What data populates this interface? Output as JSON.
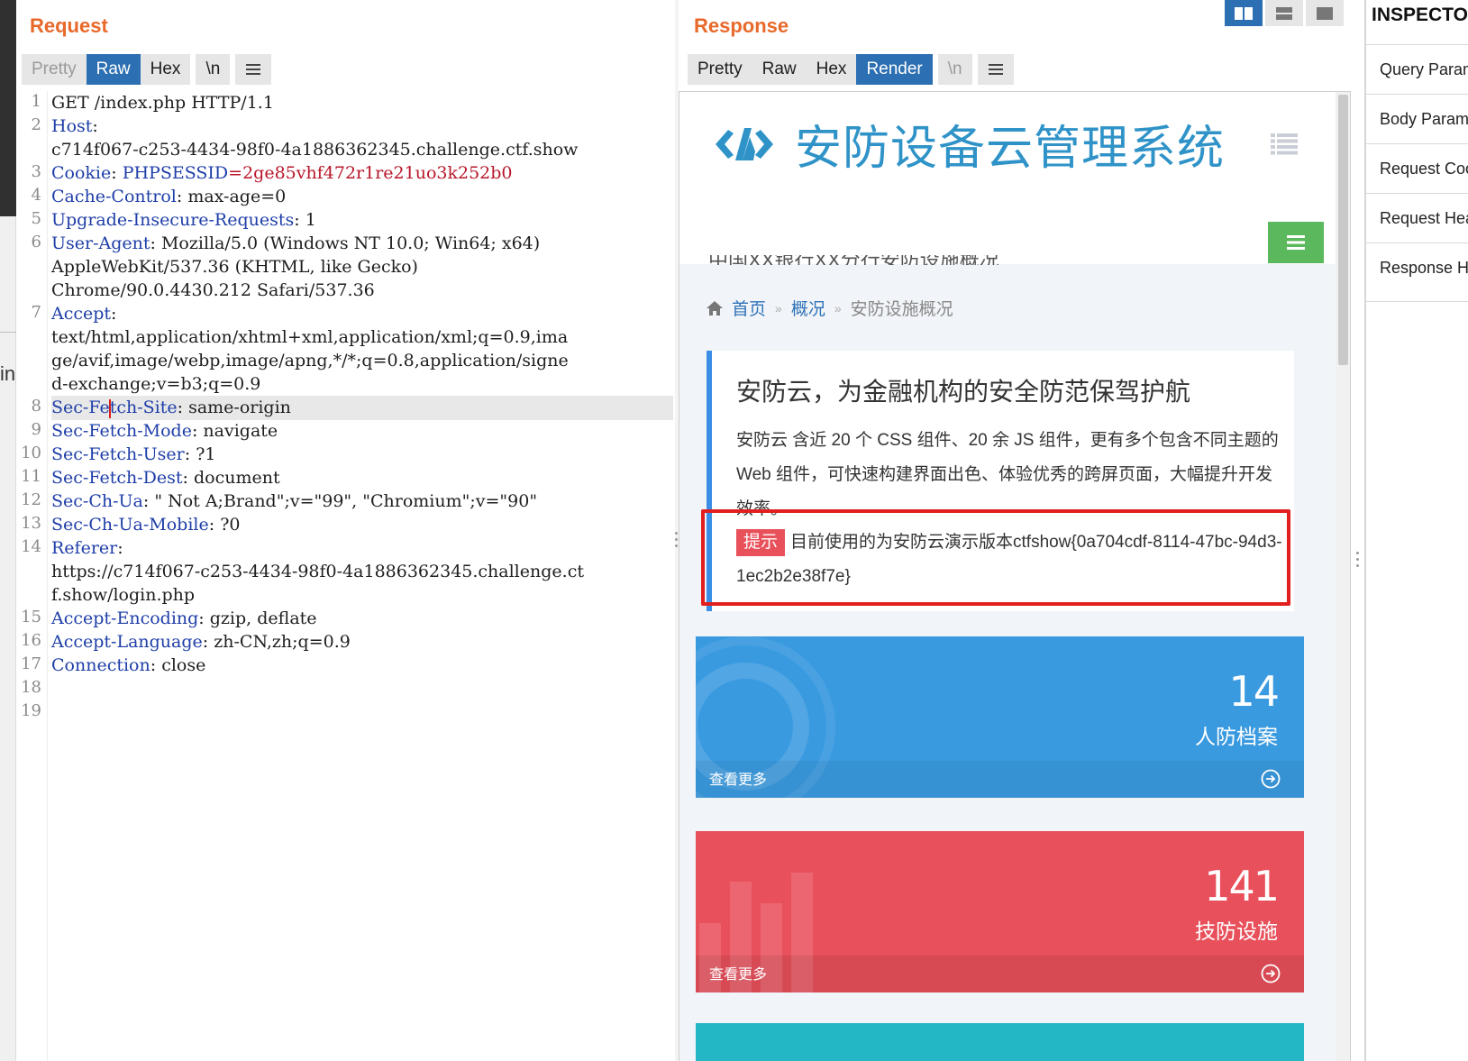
{
  "request": {
    "title": "Request",
    "tabs": [
      "Pretty",
      "Raw",
      "Hex",
      "\\n"
    ],
    "selected_tab": "Raw",
    "lines": [
      {
        "n": "1",
        "key": "",
        "sep": "",
        "value": "GET /index.php HTTP/1.1"
      },
      {
        "n": "2",
        "key": "Host",
        "sep": ":",
        "value": ""
      },
      {
        "n": "",
        "key": "",
        "sep": "",
        "value": "c714f067-c253-4434-98f0-4a1886362345.challenge.ctf.show"
      },
      {
        "n": "3",
        "key": "Cookie",
        "sep": ": ",
        "ckey": "PHPSESSID",
        "value": "=2ge85vhf472r1re21uo3k252b0"
      },
      {
        "n": "4",
        "key": "Cache-Control",
        "sep": ": ",
        "value": "max-age=0"
      },
      {
        "n": "5",
        "key": "Upgrade-Insecure-Requests",
        "sep": ": ",
        "value": "1"
      },
      {
        "n": "6",
        "key": "User-Agent",
        "sep": ": ",
        "value": "Mozilla/5.0 (Windows NT 10.0; Win64; x64)"
      },
      {
        "n": "",
        "key": "",
        "sep": "",
        "value": "AppleWebKit/537.36 (KHTML, like Gecko)"
      },
      {
        "n": "",
        "key": "",
        "sep": "",
        "value": "Chrome/90.0.4430.212 Safari/537.36"
      },
      {
        "n": "7",
        "key": "Accept",
        "sep": ":",
        "value": ""
      },
      {
        "n": "",
        "key": "",
        "sep": "",
        "value": "text/html,application/xhtml+xml,application/xml;q=0.9,ima"
      },
      {
        "n": "",
        "key": "",
        "sep": "",
        "value": "ge/avif,image/webp,image/apng,*/*;q=0.8,application/signe"
      },
      {
        "n": "",
        "key": "",
        "sep": "",
        "value": "d-exchange;v=b3;q=0.9"
      },
      {
        "n": "8",
        "key": "Sec-Fetch-Site",
        "sep": ": ",
        "value": "same-origin",
        "highlight": true
      },
      {
        "n": "9",
        "key": "Sec-Fetch-Mode",
        "sep": ": ",
        "value": "navigate"
      },
      {
        "n": "10",
        "key": "Sec-Fetch-User",
        "sep": ": ",
        "value": "?1"
      },
      {
        "n": "11",
        "key": "Sec-Fetch-Dest",
        "sep": ": ",
        "value": "document"
      },
      {
        "n": "12",
        "key": "Sec-Ch-Ua",
        "sep": ": ",
        "value": "\" Not A;Brand\";v=\"99\", \"Chromium\";v=\"90\""
      },
      {
        "n": "13",
        "key": "Sec-Ch-Ua-Mobile",
        "sep": ": ",
        "value": "?0"
      },
      {
        "n": "14",
        "key": "Referer",
        "sep": ":",
        "value": ""
      },
      {
        "n": "",
        "key": "",
        "sep": "",
        "value": "https://c714f067-c253-4434-98f0-4a1886362345.challenge.ct"
      },
      {
        "n": "",
        "key": "",
        "sep": "",
        "value": "f.show/login.php"
      },
      {
        "n": "15",
        "key": "Accept-Encoding",
        "sep": ": ",
        "value": "gzip, deflate"
      },
      {
        "n": "16",
        "key": "Accept-Language",
        "sep": ": ",
        "value": "zh-CN,zh;q=0.9"
      },
      {
        "n": "17",
        "key": "Connection",
        "sep": ": ",
        "value": "close"
      },
      {
        "n": "18",
        "key": "",
        "sep": "",
        "value": ""
      },
      {
        "n": "19",
        "key": "",
        "sep": "",
        "value": ""
      }
    ]
  },
  "response": {
    "title": "Response",
    "tabs": [
      "Pretty",
      "Raw",
      "Hex",
      "Render",
      "\\n"
    ],
    "selected_tab": "Render"
  },
  "left_edge_text": "in",
  "rendered_page": {
    "site_title": "安防设备云管理系统",
    "clipped_heading": "中国XX银行XX分行安防设施概况",
    "breadcrumb": [
      "首页",
      "概况",
      "安防设施概况"
    ],
    "info_title": "安防云，为金融机构的安全防范保驾护航",
    "info_body": "安防云 含近 20 个 CSS 组件、20 余 JS 组件，更有多个包含不同主题的 Web 组件，可快速构建界面出色、体验优秀的跨屏页面，大幅提升开发效率。",
    "tip_label": "提示",
    "tip_text": "目前使用的为安防云演示版本ctfshow{0a704cdf-8114-47bc-94d3-1ec2b2e38f7e}",
    "stats": [
      {
        "value": "14",
        "label": "人防档案",
        "more": "查看更多",
        "color": "#3a9ae0"
      },
      {
        "value": "141",
        "label": "技防设施",
        "more": "查看更多",
        "color": "#e8505b"
      }
    ]
  },
  "inspector": {
    "title": "INSPECTOR",
    "items": [
      "Query Parameters",
      "Body Parameters",
      "Request Cookies",
      "Request Headers",
      "Response Headers"
    ]
  },
  "colors": {
    "accent": "#2c6fb2",
    "title_orange": "#e8692a",
    "header_key": "#1e3ea8",
    "cookie_value": "#b8172a"
  },
  "icons": [
    "hamburger-icon",
    "split-view-icon",
    "horizontal-view-icon",
    "tabs-view-icon",
    "logo-icon",
    "list-icon",
    "menu-icon",
    "home-icon",
    "circle-arrow-icon"
  ]
}
